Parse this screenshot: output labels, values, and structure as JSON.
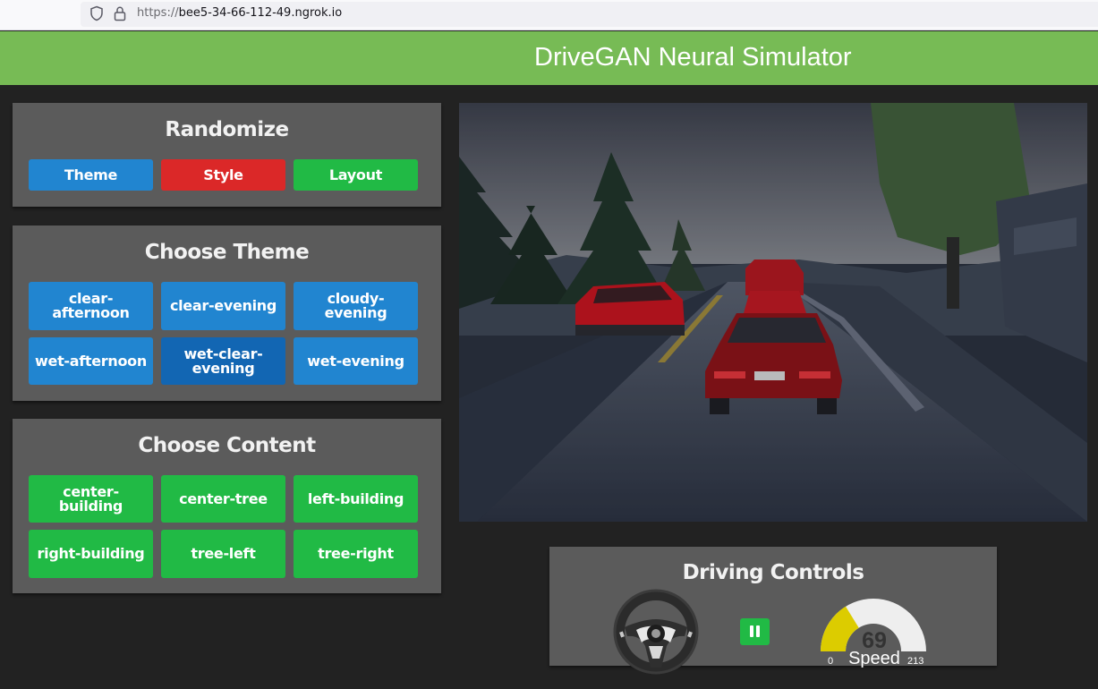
{
  "browser": {
    "url_scheme": "https://",
    "url_host": "bee5-34-66-112-49.ngrok.io",
    "icons": [
      "shield-icon",
      "lock-icon"
    ]
  },
  "header": {
    "title": "DriveGAN Neural Simulator",
    "background_color": "#77bb55"
  },
  "randomize": {
    "title": "Randomize",
    "buttons": [
      {
        "label": "Theme",
        "color": "#2185d0"
      },
      {
        "label": "Style",
        "color": "#db2828"
      },
      {
        "label": "Layout",
        "color": "#21ba45"
      }
    ]
  },
  "choose_theme": {
    "title": "Choose Theme",
    "selected": "wet-clear-evening",
    "options": [
      {
        "label": "clear-afternoon"
      },
      {
        "label": "clear-evening"
      },
      {
        "label": "cloudy-evening"
      },
      {
        "label": "wet-afternoon"
      },
      {
        "label": "wet-clear-evening"
      },
      {
        "label": "wet-evening"
      }
    ]
  },
  "choose_content": {
    "title": "Choose Content",
    "options": [
      {
        "label": "center-building"
      },
      {
        "label": "center-tree"
      },
      {
        "label": "left-building"
      },
      {
        "label": "right-building"
      },
      {
        "label": "tree-left"
      },
      {
        "label": "tree-right"
      }
    ]
  },
  "driving_controls": {
    "title": "Driving Controls",
    "steering_icon": "steering-wheel-icon",
    "pause_icon": "pause-icon",
    "speed": {
      "label": "Speed",
      "value": "69",
      "min": "0",
      "max": "213",
      "fill_color": "#dccc00",
      "track_color": "#eeeeee"
    }
  },
  "colors": {
    "panel": "#5b5b5b",
    "page_background": "#222222",
    "blue": "#2185d0",
    "blue_active": "#1266b3",
    "red": "#db2828",
    "green": "#21ba45"
  }
}
